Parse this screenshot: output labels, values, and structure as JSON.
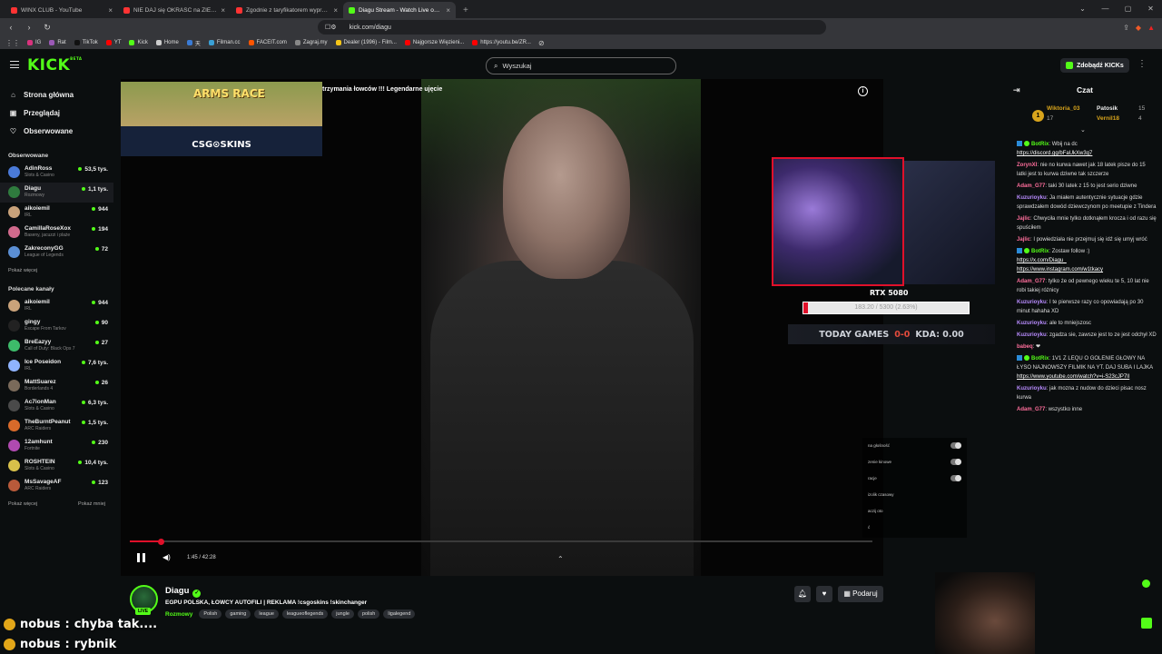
{
  "browser": {
    "tabs": [
      {
        "title": "WINX CLUB - YouTube",
        "color": "#ff3333",
        "active": false
      },
      {
        "title": "NIE DAJ się OKRAŚĆ na ZIEMNIAKACH",
        "color": "#ff3333",
        "active": false
      },
      {
        "title": "Zgodnie z taryfikatorem wyprzedzania",
        "color": "#ff3333",
        "active": false
      },
      {
        "title": "Diagu Stream - Watch Live on Kick",
        "color": "#53fc18",
        "active": true
      }
    ],
    "new_tab": "+",
    "url": "kick.com/diagu",
    "bookmarks": [
      {
        "label": "IG",
        "color": "#d9327d"
      },
      {
        "label": "Rat",
        "color": "#9b59b6"
      },
      {
        "label": "TikTok",
        "color": "#111111"
      },
      {
        "label": "YT",
        "color": "#ff0000"
      },
      {
        "label": "Kick",
        "color": "#53fc18"
      },
      {
        "label": "Home",
        "color": "#cccccc"
      },
      {
        "label": "天",
        "color": "#3a7bd5"
      },
      {
        "label": "Filman.cc",
        "color": "#3aa0d5"
      },
      {
        "label": "FACEIT.com",
        "color": "#ff5500"
      },
      {
        "label": "Zagraj.my",
        "color": "#888888"
      },
      {
        "label": "Dealer (1996) - Film...",
        "color": "#f5c518"
      },
      {
        "label": "Najgorsze Więzieni...",
        "color": "#ff0000"
      },
      {
        "label": "https://youtu.be/ZR...",
        "color": "#ff0000"
      }
    ]
  },
  "header": {
    "logo": "KICK",
    "logo_sup": "BETA",
    "search_placeholder": "Wyszukaj",
    "get_kicks": "Zdobądź KICKs"
  },
  "sidebar": {
    "nav": [
      {
        "label": "Strona główna",
        "icon": "⌂"
      },
      {
        "label": "Przeglądaj",
        "icon": "▣"
      },
      {
        "label": "Obserwowane",
        "icon": "♡"
      }
    ],
    "followed_title": "Obserwowane",
    "followed": [
      {
        "name": "AdinRoss",
        "category": "Slots & Casino",
        "viewers": "53,5 tys.",
        "color": "#4a7ad8"
      },
      {
        "name": "Diagu",
        "category": "Rozmowy",
        "viewers": "1,1 tys.",
        "color": "#2f7b3e",
        "selected": true
      },
      {
        "name": "aikoiemil",
        "category": "IRL",
        "viewers": "944",
        "color": "#c9a27a"
      },
      {
        "name": "CamillaRoseXox",
        "category": "Baseny, jacuzzi i plaże",
        "viewers": "194",
        "color": "#d16a8c"
      },
      {
        "name": "ZakreconyGG",
        "category": "League of Legends",
        "viewers": "72",
        "color": "#5b8fd4"
      }
    ],
    "show_more": "Pokaż więcej",
    "recommended_title": "Polecane kanały",
    "recommended": [
      {
        "name": "aikoiemil",
        "category": "IRL",
        "viewers": "944",
        "color": "#c9a27a"
      },
      {
        "name": "gingy",
        "category": "Escape From Tarkov",
        "viewers": "90",
        "color": "#222222"
      },
      {
        "name": "BreEazyy",
        "category": "Call of Duty: Black Ops 7",
        "viewers": "27",
        "color": "#3dbb6a"
      },
      {
        "name": "Ice Poseidon",
        "category": "IRL",
        "viewers": "7,6 tys.",
        "color": "#8fb3ff"
      },
      {
        "name": "MattSuarez",
        "category": "Borderlands 4",
        "viewers": "26",
        "color": "#7a6a5a"
      },
      {
        "name": "Ac7ionMan",
        "category": "Slots & Casino",
        "viewers": "6,3 tys.",
        "color": "#4a4a4a"
      },
      {
        "name": "TheBurntPeanut",
        "category": "ARC Raiders",
        "viewers": "1,5 tys.",
        "color": "#d86a2a"
      },
      {
        "name": "12amhunt",
        "category": "Fortnite",
        "viewers": "230",
        "color": "#b04ab0"
      },
      {
        "name": "ROSHTEIN",
        "category": "Slots & Casino",
        "viewers": "10,4 tys.",
        "color": "#d8c04a"
      },
      {
        "name": "MsSavageAF",
        "category": "ARC Raiders",
        "viewers": "123",
        "color": "#b85a3a"
      }
    ],
    "show_more_2": "Pokaż więcej",
    "show_less": "Pokaż mniej"
  },
  "video": {
    "banner_title": "ARMS RACE",
    "banner_sub": "CSG⊙SKINS",
    "overlay_title": "trzymania łowców !!! Legendarne ujęcie",
    "goal_label": "RTX 5080",
    "goal_text": "183.20 / 5300 (2.63%)",
    "goal_fraction": 0.0263,
    "stats_label": "TODAY GAMES",
    "stats_score": "0-0",
    "stats_kda": "KDA: 0.00",
    "settings": [
      "na głośność",
      "zenie kinowe",
      "racje",
      "izolik czasowy",
      "aczij oto",
      "ć"
    ],
    "progress_fraction": 0.0412,
    "time": "1:45 / 42:28"
  },
  "stream": {
    "name": "Diagu",
    "live": "LIVE",
    "title": "EGPU POLSKA, ŁOWCY AUTOFILI | REKLAMA !csgoskins !skinchanger",
    "category": "Rozmowy",
    "tags": [
      "Polish",
      "gaming",
      "league",
      "leagueoflegends",
      "jungle",
      "polish",
      "ligalegend"
    ],
    "gift": "Podaruj"
  },
  "chat": {
    "title": "Czat",
    "leaderboard": [
      {
        "name": "Wiktoria_03",
        "count": "17",
        "color": "#d8a41c"
      },
      {
        "name": "Patosik",
        "count": "15",
        "color": "#eeeeee"
      },
      {
        "name": "Vernil18",
        "count": "4",
        "color": "#d8a41c"
      }
    ],
    "messages": [
      {
        "user": "BotRix",
        "color": "#53fc18",
        "bot": true,
        "text": "Wbij na dc",
        "link": "https://discord.gg/bFaUkXw3g7"
      },
      {
        "user": "ZorynXI",
        "color": "#ff6e9c",
        "text": "nie no kurwa nawet jak 18 latek pisze do 15 latki jest to kurwa dziwne tak szczerze"
      },
      {
        "user": "Adam_G77",
        "color": "#ff6e9c",
        "text": "taki 30 latek z 15 to jest serio dziwne"
      },
      {
        "user": "Kuzurioyku",
        "color": "#b98cff",
        "text": "Ja miałem autentycznie sytuacje gdzie sprawdzałem dowód dziewczynom po meetupie z Tindera"
      },
      {
        "user": "Jajlic",
        "color": "#ff6e9c",
        "text": "Chwyciła mnie tylko dotknąłem krocza i od razu się spuściłem"
      },
      {
        "user": "Jajlic",
        "color": "#ff6e9c",
        "text": "I powiedziała nie przejmuj się idź się umyj wróć"
      },
      {
        "user": "BotRix",
        "color": "#53fc18",
        "bot": true,
        "text": "Zostaw follow :)",
        "link": "https://x.com/Diagu_",
        "link2": "https://www.instagram.com/w1tkacy"
      },
      {
        "user": "Adam_G77",
        "color": "#ff6e9c",
        "text": "tylko że od pewnego wieku te 5, 10 lat nie robi takiej różnicy"
      },
      {
        "user": "Kuzurioyku",
        "color": "#b98cff",
        "text": "I te pierwsze razy co opowiadają po 30 minut hahaha XD"
      },
      {
        "user": "Kuzurioyku",
        "color": "#b98cff",
        "text": "ale to mniejszosc"
      },
      {
        "user": "Kuzurioyku",
        "color": "#b98cff",
        "text": "zgadza sie, zawsze jest to ze jest odchył XD"
      },
      {
        "user": "babeq",
        "color": "#ff6e9c",
        "text": "❤"
      },
      {
        "user": "BotRix",
        "color": "#53fc18",
        "bot": true,
        "text": "1V1 Z LEQU O GOLENIE GŁOWY NA ŁYSO NAJNOWSZY FILMIK NA YT. DAJ SUBA I LAJKA",
        "link": "https://www.youtube.com/watch?v=i-S23cJP7lI"
      },
      {
        "user": "Kuzurioyku",
        "color": "#b98cff",
        "text": "jak mozna z nudow do dzieci pisac nosz kurwa"
      },
      {
        "user": "Adam_G77",
        "color": "#ff6e9c",
        "text": "wszystko inne"
      }
    ]
  },
  "overlay_chat": [
    {
      "user": "nobus",
      "text": "chyba tak...."
    },
    {
      "user": "nobus",
      "text": "rybnik"
    }
  ]
}
